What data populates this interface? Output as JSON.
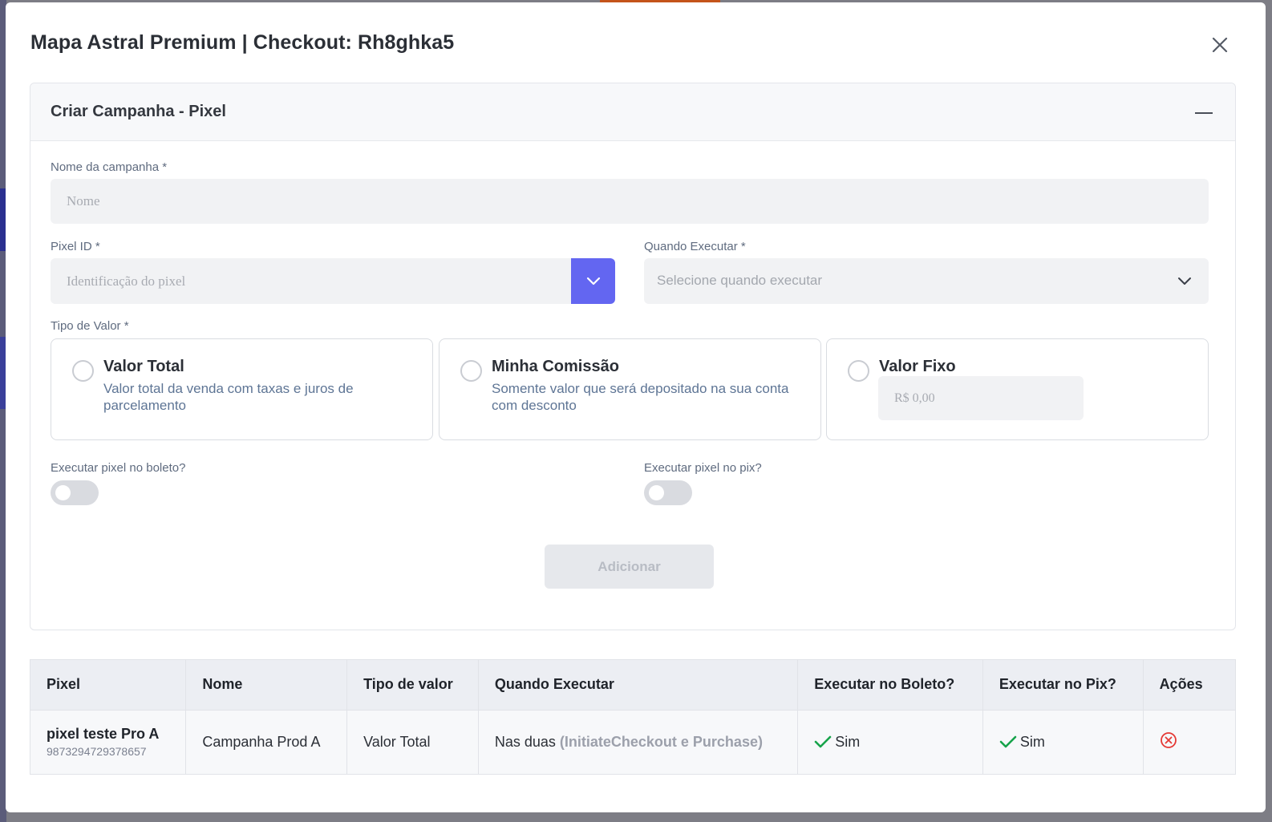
{
  "modal": {
    "title": "Mapa Astral Premium | Checkout: Rh8ghka5"
  },
  "card": {
    "title": "Criar Campanha - Pixel"
  },
  "form": {
    "campaign_name": {
      "label": "Nome da campanha *",
      "placeholder": "Nome",
      "value": ""
    },
    "pixel_id": {
      "label": "Pixel ID *",
      "placeholder": "Identificação do pixel",
      "value": ""
    },
    "when_execute": {
      "label": "Quando Executar *",
      "placeholder": "Selecione quando executar"
    },
    "value_type": {
      "label": "Tipo de Valor *",
      "options": [
        {
          "title": "Valor Total",
          "description": "Valor total da venda com taxas e juros de parcelamento"
        },
        {
          "title": "Minha Comissão",
          "description": "Somente valor que será depositado na sua conta com desconto"
        },
        {
          "title": "Valor Fixo",
          "placeholder": "R$ 0,00"
        }
      ]
    },
    "boleto_toggle": {
      "label": "Executar pixel no boleto?",
      "enabled": false
    },
    "pix_toggle": {
      "label": "Executar pixel no pix?",
      "enabled": false
    },
    "add_label": "Adicionar"
  },
  "table": {
    "headers": [
      "Pixel",
      "Nome",
      "Tipo de valor",
      "Quando Executar",
      "Executar no Boleto?",
      "Executar no Pix?",
      "Ações"
    ],
    "rows": [
      {
        "pixel_name": "pixel teste Pro A",
        "pixel_id": "9873294729378657",
        "name": "Campanha Prod A",
        "value_type": "Valor Total",
        "when_main": "Nas duas",
        "when_detail": "(InitiateCheckout e Purchase)",
        "boleto": "Sim",
        "pix": "Sim"
      }
    ]
  },
  "colors": {
    "accent": "#6366f1",
    "success": "#16a34a",
    "danger": "#e53935"
  },
  "icons": {
    "close": "close-icon",
    "collapse": "minus-icon",
    "dropdown": "chevron-down-icon",
    "check": "check-icon",
    "delete": "circle-x-icon"
  }
}
